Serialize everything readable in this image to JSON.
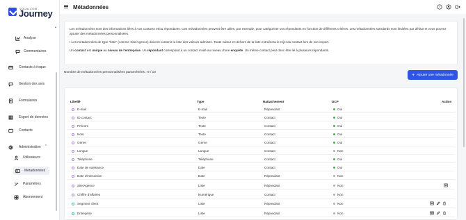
{
  "brand": {
    "small": "VOCALCOM",
    "name": "Journey",
    "accent": "#2e4fe0"
  },
  "sidebar": {
    "items": [
      {
        "label": "Analyse",
        "icon": "analytics-icon"
      },
      {
        "label": "Commentaires",
        "icon": "comments-icon"
      },
      {
        "label": "Contacts à risque",
        "icon": "risk-contacts-icon"
      },
      {
        "label": "Gestion des avis",
        "icon": "reviews-icon"
      },
      {
        "label": "Formulaires",
        "icon": "forms-icon"
      },
      {
        "label": "Export de données",
        "icon": "export-icon"
      },
      {
        "label": "Contacts",
        "icon": "contacts-icon"
      },
      {
        "label": "Administration",
        "icon": "settings-icon",
        "expanded": true
      }
    ],
    "sub_items": [
      {
        "label": "Utilisateurs",
        "icon": "users-icon"
      },
      {
        "label": "Métadonnées",
        "icon": "metadata-icon",
        "active": true
      },
      {
        "label": "Paramètres",
        "icon": "parameters-icon"
      },
      {
        "label": "Abonnement",
        "icon": "subscription-icon"
      }
    ]
  },
  "header": {
    "title": "Métadonnées"
  },
  "info": {
    "p1": "Les métadonnées sont des informations liées à vos contacts et/ou répondants. Ces métadonnées peuvent être utiles, par exemple, pour catégoriser vos répondants en fonction de différents critères. Les métadonnées standards sont limitées par défaut et vous pouvez ajouter des métadonnées personnalisées.",
    "p2": "!   Les métadonnées de type \"liste\" (comme Site/Agence) doivent contenir la liste des valeurs admises. Toute valeur en dehors de la liste entraînera le rejet du contact lors de son import.",
    "p3_a": "Un ",
    "p3_b": "contact",
    "p3_c": " est ",
    "p3_d": "unique",
    "p3_e": " au ",
    "p3_f": "niveau de l'entreprise",
    "p3_g": ". Un ",
    "p3_h": "répondant",
    "p3_i": " correspond à un contact invité au niveau d'une ",
    "p3_j": "enquête",
    "p3_k": ". Un même contact peut donc être lié à plusieurs répondants."
  },
  "count_label": "Nombre de métadonnées personnalisées paramétrées : 9 / 10",
  "add_button": "Ajouter une métadonnée",
  "table": {
    "headers": {
      "libelle": "Libellé",
      "type": "Type",
      "rattachement": "Rattachement",
      "dcp": "DCP",
      "action": "Action"
    },
    "rows": [
      {
        "libelle": "E-mail",
        "type": "E-mail",
        "rattachement": "Répondant",
        "dcp": "Oui",
        "custom": false
      },
      {
        "libelle": "ID contact",
        "type": "Texte",
        "rattachement": "Contact",
        "dcp": "Oui",
        "custom": false
      },
      {
        "libelle": "Prénom",
        "type": "Texte",
        "rattachement": "Contact",
        "dcp": "Oui",
        "custom": false
      },
      {
        "libelle": "Nom",
        "type": "Texte",
        "rattachement": "Contact",
        "dcp": "Oui",
        "custom": false
      },
      {
        "libelle": "Genre",
        "type": "Genre",
        "rattachement": "Contact",
        "dcp": "Oui",
        "custom": false
      },
      {
        "libelle": "Langue",
        "type": "Langue",
        "rattachement": "Contact",
        "dcp": "Non",
        "custom": false
      },
      {
        "libelle": "Téléphone",
        "type": "Téléphone",
        "rattachement": "Contact",
        "dcp": "Oui",
        "custom": false
      },
      {
        "libelle": "Date de naissance",
        "type": "Date",
        "rattachement": "Contact",
        "dcp": "Oui",
        "custom": false
      },
      {
        "libelle": "Date d'interaction",
        "type": "Date",
        "rattachement": "Répondant",
        "dcp": "Non",
        "custom": false
      },
      {
        "libelle": "Site/Agence",
        "type": "Liste",
        "rattachement": "Répondant",
        "dcp": "Non",
        "custom": false,
        "list_icon": true
      },
      {
        "libelle": "Chiffre d'affaires",
        "type": "Numérique",
        "rattachement": "Contact",
        "dcp": "Non",
        "custom": false
      },
      {
        "libelle": "Segment client",
        "type": "Liste",
        "rattachement": "Répondant",
        "dcp": "Non",
        "custom": true
      },
      {
        "libelle": "Entreprise",
        "type": "Liste",
        "rattachement": "Répondant",
        "dcp": "Non",
        "custom": true
      }
    ]
  },
  "colors": {
    "oui": "#4caf50",
    "non": "#b0b0b0",
    "button": "#2e56e6"
  }
}
